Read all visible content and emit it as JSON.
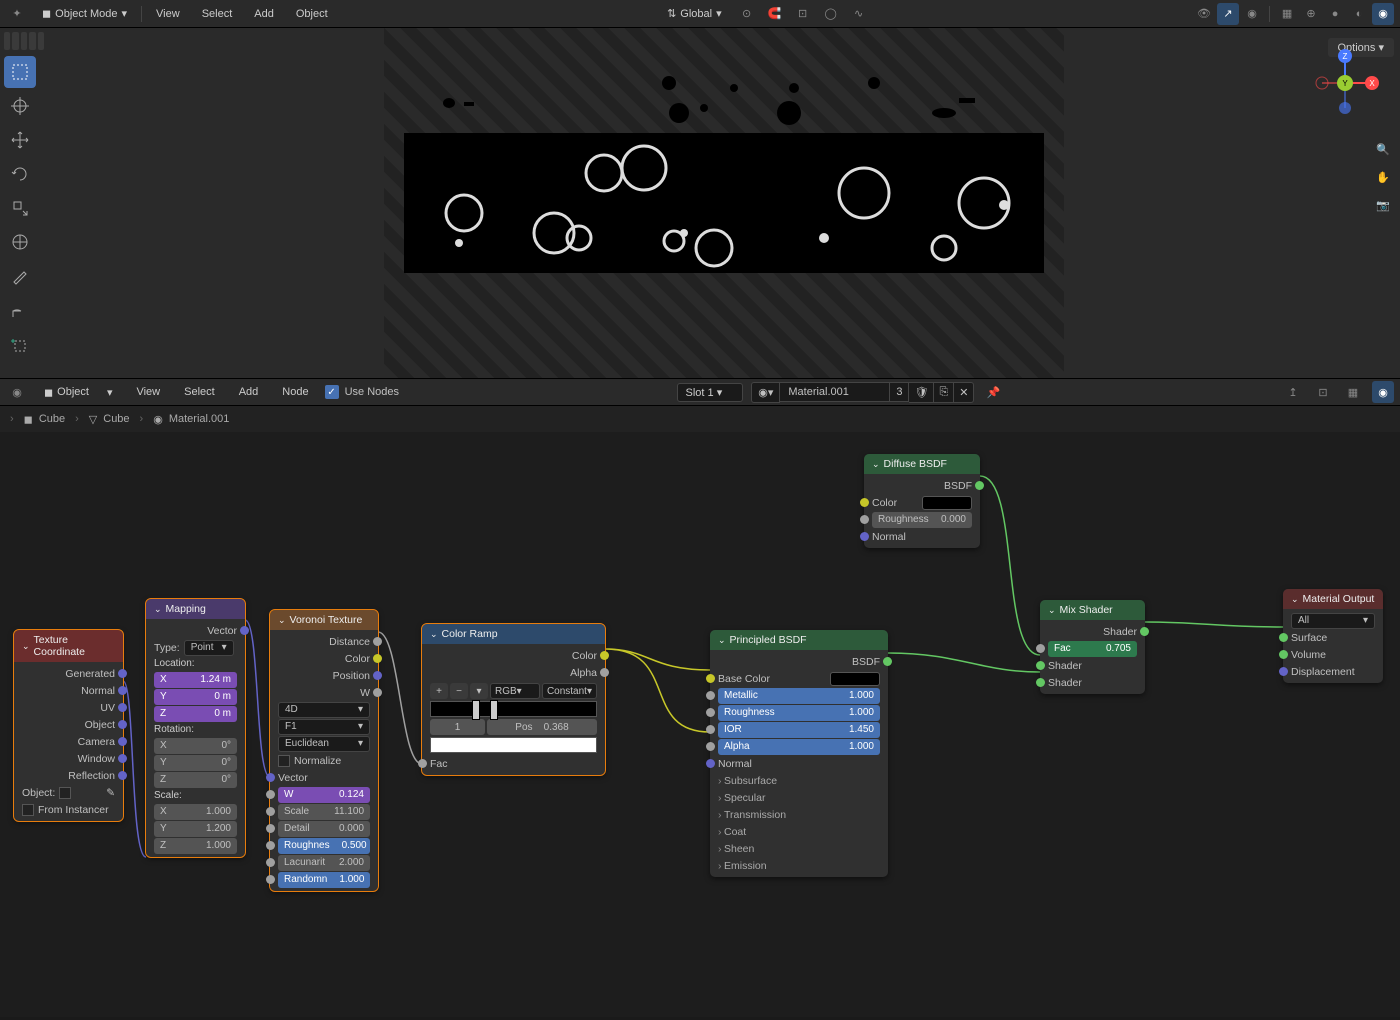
{
  "header": {
    "mode": "Object Mode",
    "menus": [
      "View",
      "Select",
      "Add",
      "Object"
    ],
    "orientation": "Global",
    "options_label": "Options"
  },
  "viewport": {
    "gizmo": {
      "x": "X",
      "y": "Y",
      "z": "Z"
    }
  },
  "node_header": {
    "editor_type": "Object",
    "menus": [
      "View",
      "Select",
      "Add",
      "Node"
    ],
    "use_nodes_label": "Use Nodes",
    "slot": "Slot 1",
    "material_name": "Material.001",
    "material_users": "3"
  },
  "breadcrumb": {
    "items": [
      "Cube",
      "Cube",
      "Material.001"
    ]
  },
  "nodes": {
    "tex_coord": {
      "title": "Texture Coordinate",
      "outputs": [
        "Generated",
        "Normal",
        "UV",
        "Object",
        "Camera",
        "Window",
        "Reflection"
      ],
      "object_label": "Object:",
      "instancer_label": "From Instancer"
    },
    "mapping": {
      "title": "Mapping",
      "vector_out": "Vector",
      "type_label": "Type:",
      "type_value": "Point",
      "location_label": "Location:",
      "loc_x": "X",
      "loc_x_val": "1.24 m",
      "loc_y": "Y",
      "loc_y_val": "0 m",
      "loc_z": "Z",
      "loc_z_val": "0 m",
      "rotation_label": "Rotation:",
      "rot_x": "X",
      "rot_x_val": "0°",
      "rot_y": "Y",
      "rot_y_val": "0°",
      "rot_z": "Z",
      "rot_z_val": "0°",
      "scale_label": "Scale:",
      "scl_x": "X",
      "scl_x_val": "1.000",
      "scl_y": "Y",
      "scl_y_val": "1.200",
      "scl_z": "Z",
      "scl_z_val": "1.000"
    },
    "voronoi": {
      "title": "Voronoi Texture",
      "outputs": [
        "Distance",
        "Color",
        "Position",
        "W"
      ],
      "dim": "4D",
      "dist": "Euclidean",
      "feat": "F1",
      "normalize": "Normalize",
      "vector_label": "Vector",
      "w_label": "W",
      "w_val": "0.124",
      "scale_label": "Scale",
      "scale_val": "11.100",
      "detail_label": "Detail",
      "detail_val": "0.000",
      "rough_label": "Roughnes",
      "rough_val": "0.500",
      "lac_label": "Lacunarit",
      "lac_val": "2.000",
      "rand_label": "Randomn",
      "rand_val": "1.000"
    },
    "ramp": {
      "title": "Color Ramp",
      "color_out": "Color",
      "alpha_out": "Alpha",
      "interp": "RGB",
      "mode": "Constant",
      "stop_index": "1",
      "pos_label": "Pos",
      "pos_val": "0.368",
      "fac_label": "Fac"
    },
    "principled": {
      "title": "Principled BSDF",
      "bsdf_out": "BSDF",
      "base_color": "Base Color",
      "metallic": "Metallic",
      "metallic_val": "1.000",
      "roughness": "Roughness",
      "roughness_val": "1.000",
      "ior": "IOR",
      "ior_val": "1.450",
      "alpha": "Alpha",
      "alpha_val": "1.000",
      "normal": "Normal",
      "expands": [
        "Subsurface",
        "Specular",
        "Transmission",
        "Coat",
        "Sheen",
        "Emission"
      ]
    },
    "diffuse": {
      "title": "Diffuse BSDF",
      "bsdf_out": "BSDF",
      "color": "Color",
      "roughness": "Roughness",
      "roughness_val": "0.000",
      "normal": "Normal"
    },
    "mix": {
      "title": "Mix Shader",
      "shader_out": "Shader",
      "fac": "Fac",
      "fac_val": "0.705",
      "shader1": "Shader",
      "shader2": "Shader"
    },
    "output": {
      "title": "Material Output",
      "target": "All",
      "surface": "Surface",
      "volume": "Volume",
      "disp": "Displacement"
    }
  }
}
